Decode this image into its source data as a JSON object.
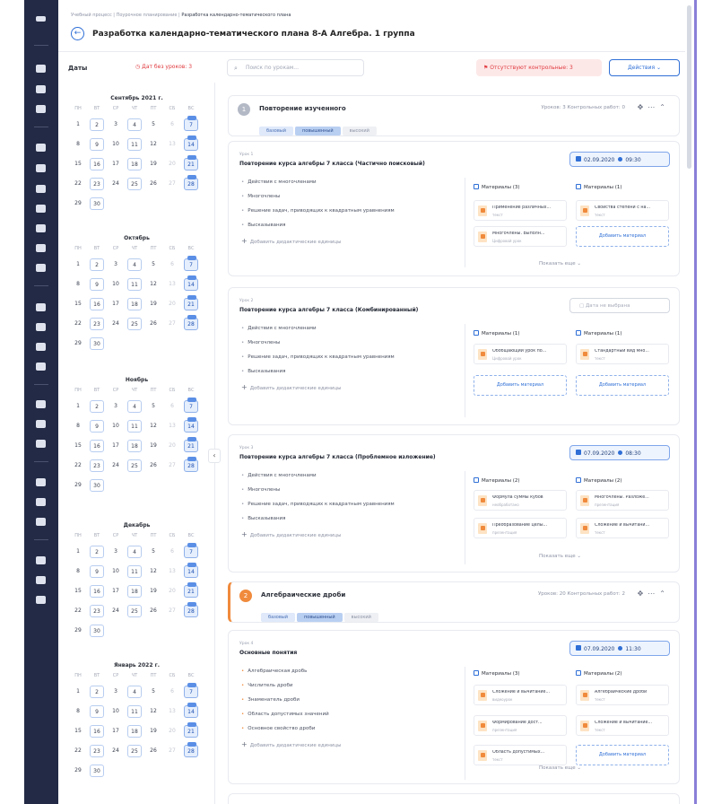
{
  "breadcrumb": [
    "Учебный процесс",
    "Поурочное планирование",
    "Разработка календарно-тематического плана"
  ],
  "title": "Разработка календарно-тематического плана 8-А Алгебра. 1 группа",
  "dates_label": "Даты",
  "days_without_lessons": "Дат без уроков: 3",
  "search_placeholder": "Поиск по урокам...",
  "missing_controls": "Отсутствуют контрольные: 3",
  "actions_label": "Действия",
  "add_units": "Добавить дидактические единицы",
  "add_material": "Добавить материал",
  "show_more": "Показать еще",
  "levels": [
    "базовый",
    "повышенный",
    "высокий"
  ],
  "weekdays": [
    "ПН",
    "ВТ",
    "СР",
    "ЧТ",
    "ПТ",
    "СБ",
    "ВС"
  ],
  "months": [
    {
      "name": "Сентябрь 2021 г.",
      "blue": [
        7,
        14,
        21,
        28
      ],
      "boxed": [
        2,
        9,
        16,
        23,
        30,
        11,
        18,
        25
      ],
      "plain_border": [
        4
      ]
    },
    {
      "name": "Октябрь",
      "blue": [
        7,
        14,
        21,
        28
      ],
      "boxed": [
        2,
        9,
        16,
        23,
        30,
        11,
        18,
        25
      ],
      "plain_border": [
        4
      ]
    },
    {
      "name": "Ноябрь",
      "blue": [
        7,
        14,
        21,
        28
      ],
      "boxed": [
        2,
        9,
        16,
        23,
        30,
        11,
        18,
        25
      ],
      "plain_border": [
        4
      ]
    },
    {
      "name": "Декабрь",
      "blue": [
        7,
        14,
        21,
        28
      ],
      "boxed": [
        2,
        9,
        16,
        23,
        30,
        11,
        18,
        25
      ],
      "plain_border": [
        4
      ]
    },
    {
      "name": "Январь 2022 г.",
      "blue": [
        7,
        14,
        21,
        28
      ],
      "boxed": [
        2,
        9,
        16,
        23,
        30,
        11,
        18,
        25
      ],
      "plain_border": [
        4
      ]
    }
  ],
  "sections": [
    {
      "num": "1",
      "title": "Повторение изученного",
      "stats": "Уроков: 3   Контрольных работ: 0"
    },
    {
      "num": "2",
      "title": "Алгебраические дроби",
      "stats": "Уроков: 20   Контрольных работ: 2"
    }
  ],
  "lessons": [
    {
      "num": "Урок 1",
      "title": "Повторение курса алгебры 7 класса (Частично поисковый)",
      "date": "02.09.2020",
      "time": "09:30",
      "items": [
        "Действия с многочленами",
        "Многочлены",
        "Решение задач, приводящих к квадратным уравнениям",
        "Высказывания"
      ],
      "m1_head": "Материалы (3)",
      "m2_head": "Материалы (1)",
      "c1": [
        {
          "t": "Применение различных...",
          "s": "текст"
        },
        {
          "t": "Многочлены. Выполн...",
          "s": "Цифровой урок"
        }
      ],
      "c2": [
        {
          "t": "Свойства степени с на...",
          "s": "текст"
        }
      ]
    },
    {
      "num": "Урок 2",
      "title": "Повторение курса алгебры 7 класса (Комбинированный)",
      "date_empty": "Дата не выбрана",
      "items": [
        "Действия с многочленами",
        "Многочлены",
        "Решение задач, приводящих к квадратным уравнениям",
        "Высказывания"
      ],
      "m1_head": "Материалы (1)",
      "m2_head": "Материалы (1)",
      "c1": [
        {
          "t": "Обобщающий урок по...",
          "s": "Цифровой урок"
        }
      ],
      "c2": [
        {
          "t": "Стандартный вид мно...",
          "s": "текст"
        }
      ]
    },
    {
      "num": "Урок 3",
      "title": "Повторение курса алгебры 7 класса (Проблемное изложение)",
      "date": "07.09.2020",
      "time": "08:30",
      "items": [
        "Действия с многочленами",
        "Многочлены",
        "Решение задач, приводящих к квадратным уравнениям",
        "Высказывания"
      ],
      "m1_head": "Материалы (2)",
      "m2_head": "Материалы (2)",
      "c1": [
        {
          "t": "Формула суммы кубов",
          "s": "необработано"
        },
        {
          "t": "Преобразование целы...",
          "s": "презентация"
        }
      ],
      "c2": [
        {
          "t": "Многочлены. Разложе...",
          "s": "презентация"
        },
        {
          "t": "Сложение и вычитани...",
          "s": "текст"
        }
      ]
    },
    {
      "num": "Урок 4",
      "title": "Основные понятия",
      "date": "07.09.2020",
      "time": "11:30",
      "items": [
        "Алгебраическая дробь",
        "Числитель дроби",
        "Знаменатель дроби",
        "Область допустимых значений",
        "Основное свойство дроби"
      ],
      "m1_head": "Материалы (3)",
      "m2_head": "Материалы (2)",
      "c1": [
        {
          "t": "Сложение и вычитание...",
          "s": "видеоурок"
        },
        {
          "t": "Формирование дост...",
          "s": "презентация"
        },
        {
          "t": "Область допустимых...",
          "s": "текст"
        }
      ],
      "c2": [
        {
          "t": "Алгебраические дроби",
          "s": "текст"
        },
        {
          "t": "Сложение и вычитание...",
          "s": "текст"
        }
      ]
    }
  ]
}
